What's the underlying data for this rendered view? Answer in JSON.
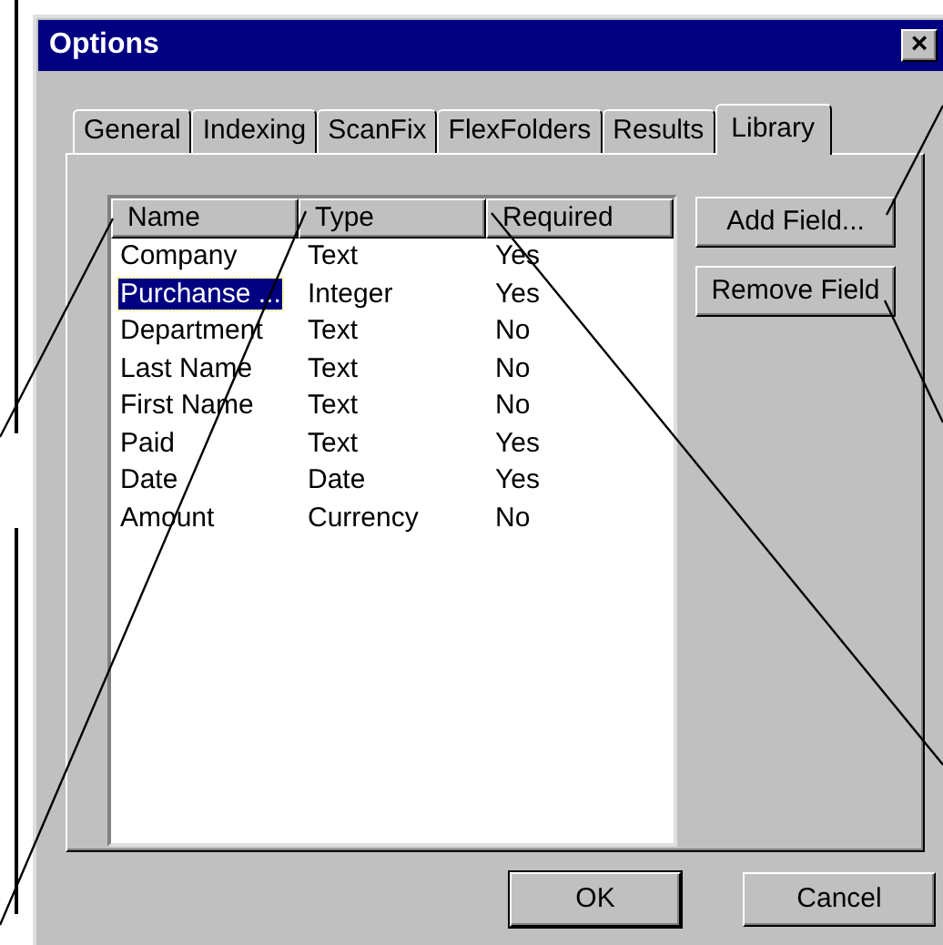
{
  "window": {
    "title": "Options",
    "close": "×"
  },
  "tabs": [
    {
      "label": "General",
      "selected": false
    },
    {
      "label": "Indexing",
      "selected": false
    },
    {
      "label": "ScanFix",
      "selected": false
    },
    {
      "label": "FlexFolders",
      "selected": false
    },
    {
      "label": "Results",
      "selected": false
    },
    {
      "label": "Library",
      "selected": true
    }
  ],
  "table": {
    "columns": [
      "Name",
      "Type",
      "Required"
    ],
    "rows": [
      {
        "cells": [
          "Company",
          "Text",
          "Yes"
        ],
        "selected": false
      },
      {
        "cells": [
          "Purchanse ...",
          "Integer",
          "Yes"
        ],
        "selected": true
      },
      {
        "cells": [
          "Department",
          "Text",
          "No"
        ],
        "selected": false
      },
      {
        "cells": [
          "Last Name",
          "Text",
          "No"
        ],
        "selected": false
      },
      {
        "cells": [
          "First Name",
          "Text",
          "No"
        ],
        "selected": false
      },
      {
        "cells": [
          "Paid",
          "Text",
          "Yes"
        ],
        "selected": false
      },
      {
        "cells": [
          "Date",
          "Date",
          "Yes"
        ],
        "selected": false
      },
      {
        "cells": [
          "Amount",
          "Currency",
          "No"
        ],
        "selected": false
      }
    ]
  },
  "side_buttons": [
    "Add Field...",
    "Remove Field"
  ],
  "buttons": [
    "OK",
    "Cancel"
  ]
}
